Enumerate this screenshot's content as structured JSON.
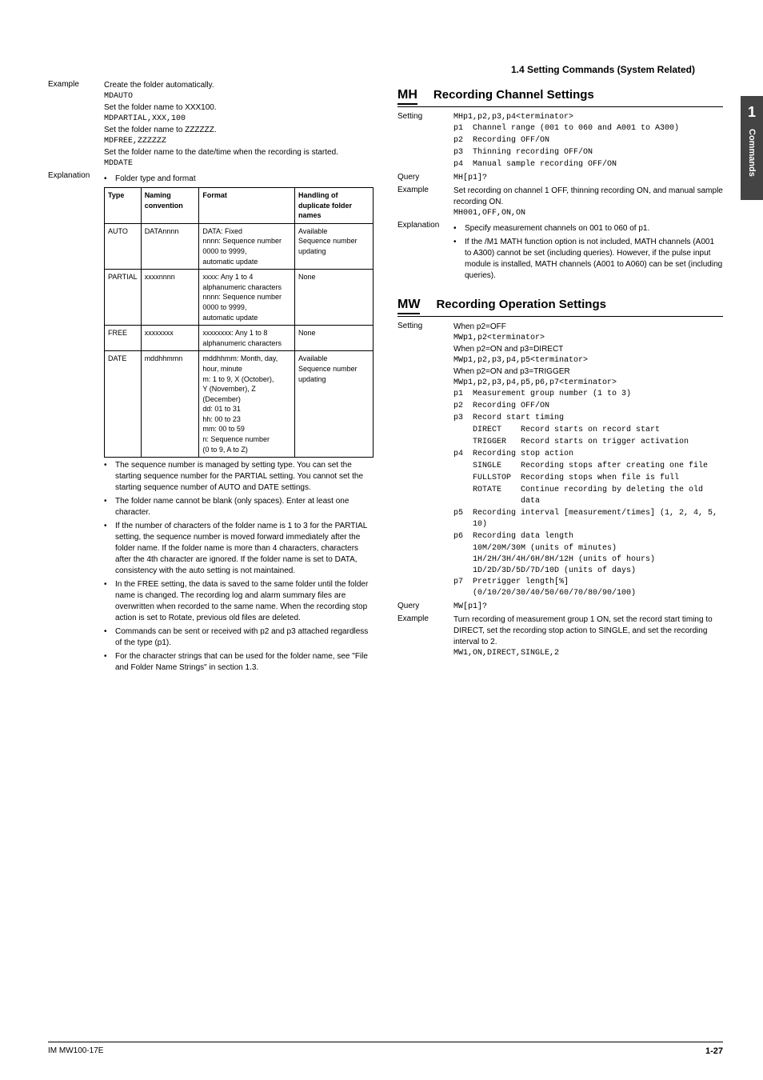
{
  "header_section": "1.4  Setting Commands (System Related)",
  "side": {
    "chapter": "1",
    "label": "Commands"
  },
  "left": {
    "example_label": "Example",
    "example_text": "Create the folder automatically.",
    "ex_lines": [
      {
        "t": "mono",
        "v": "MDAUTO"
      },
      {
        "t": "plain",
        "v": "Set the folder name to XXX100."
      },
      {
        "t": "mono",
        "v": "MDPARTIAL,XXX,100"
      },
      {
        "t": "plain",
        "v": "Set the folder name to ZZZZZZ."
      },
      {
        "t": "mono",
        "v": "MDFREE,ZZZZZZ"
      },
      {
        "t": "plain",
        "v": "Set the folder name to the date/time when the recording is started."
      },
      {
        "t": "mono",
        "v": "MDDATE"
      }
    ],
    "explanation_label": "Explanation",
    "exp_bullet1": "Folder type and format",
    "table": {
      "head": [
        "Type",
        "Naming convention",
        "Format",
        "Handling of duplicate folder names"
      ],
      "rows": [
        [
          "AUTO",
          "DATAnnnn",
          "DATA: Fixed\nnnnn: Sequence number\n     0000 to 9999,\n     automatic update",
          "Available\nSequence number updating"
        ],
        [
          "PARTIAL",
          "xxxxnnnn",
          "xxxx: Any 1 to 4 alphanumeric characters\nnnnn: Sequence number\n     0000 to 9999,\n     automatic update",
          "None"
        ],
        [
          "FREE",
          "xxxxxxxx",
          "xxxxxxxx: Any 1 to 8 alphanumeric characters",
          "None"
        ],
        [
          "DATE",
          "mddhhmmn",
          "mddhhmm: Month, day,\n           hour, minute\nm: 1 to 9, X (October),\n   Y (November), Z\n   (December)\ndd: 01 to 31\nhh: 00 to 23\nmm: 00 to 59\nn: Sequence number\n   (0 to 9, A to Z)",
          "Available\nSequence number updating"
        ]
      ]
    },
    "bullets": [
      "The sequence number is managed by setting type. You can set the starting sequence number for the PARTIAL setting. You cannot set the starting sequence number of AUTO and DATE settings.",
      "The folder name cannot be blank (only spaces). Enter at least one character.",
      "If the number of characters of the folder name is 1 to 3 for the PARTIAL setting, the sequence number is moved forward immediately after the folder name. If the folder name is more than 4 characters, characters after the 4th character are ignored. If the folder name is set to DATA, consistency with the auto setting is not maintained.",
      "In the FREE setting, the data is saved to the same folder until the folder name is changed. The recording log and alarm summary files are overwritten when recorded to the same name. When the recording stop action is set to Rotate, previous old files are deleted.",
      "Commands can be sent or received with p2 and p3 attached regardless of the type (p1).",
      "For the character strings that can be used for the folder name, see \"File and Folder Name Strings\" in section 1.3."
    ]
  },
  "right": {
    "mh": {
      "cmd": "MH",
      "title": "Recording Channel Settings",
      "setting_label": "Setting",
      "setting_syntax": "MHp1,p2,p3,p4<terminator>",
      "params": [
        {
          "n": "p1",
          "d": "Channel range (001 to 060 and A001 to A300)"
        },
        {
          "n": "p2",
          "d": "Recording OFF/ON"
        },
        {
          "n": "p3",
          "d": "Thinning recording OFF/ON"
        },
        {
          "n": "p4",
          "d": "Manual sample recording OFF/ON"
        }
      ],
      "query_label": "Query",
      "query": "MH[p1]?",
      "example_label": "Example",
      "example_text": "Set recording on channel 1 OFF, thinning recording ON, and manual sample recording ON.",
      "example_code": "MH001,OFF,ON,ON",
      "explanation_label": "Explanation",
      "exp_bullets": [
        "Specify measurement channels on 001 to 060 of p1.",
        "If the /M1 MATH function option is not included, MATH channels (A001 to A300) cannot be set (including queries). However, if the pulse input module is installed, MATH channels (A001 to A060) can be set (including queries)."
      ]
    },
    "mw": {
      "cmd": "MW",
      "title": "Recording Operation Settings",
      "setting_label": "Setting",
      "cond1": "When p2=OFF",
      "syn1": "MWp1,p2<terminator>",
      "cond2": "When p2=ON and p3=DIRECT",
      "syn2": "MWp1,p2,p3,p4,p5<terminator>",
      "cond3": "When p2=ON and p3=TRIGGER",
      "syn3": "MWp1,p2,p3,p4,p5,p6,p7<terminator>",
      "params": [
        {
          "n": "p1",
          "d": "Measurement group number (1 to 3)"
        },
        {
          "n": "p2",
          "d": "Recording OFF/ON"
        }
      ],
      "p3_label": "p3",
      "p3_head": "Record   start timing",
      "p3_subs": [
        {
          "n": "DIRECT",
          "d": "Record starts on record start"
        },
        {
          "n": "TRIGGER",
          "d": "Record starts on trigger activation"
        }
      ],
      "p4_label": "p4",
      "p4_head": "Recording stop action",
      "p4_subs": [
        {
          "n": "SINGLE",
          "d": "Recording stops after creating one file"
        },
        {
          "n": "FULLSTOP",
          "d": "Recording stops when file is full"
        },
        {
          "n": "ROTATE",
          "d": "Continue recording by deleting the old data"
        }
      ],
      "p5": {
        "n": "p5",
        "d": "Recording interval [measurement/times] (1, 2, 4, 5, 10)"
      },
      "p6": {
        "n": "p6",
        "d": "Recording data length",
        "lines": [
          "10M/20M/30M (units of minutes)",
          "1H/2H/3H/4H/6H/8H/12H (units of hours)",
          "1D/2D/3D/5D/7D/10D (units of days)"
        ]
      },
      "p7": {
        "n": "p7",
        "d": "Pretrigger length[%] (0/10/20/30/40/50/60/70/80/90/100)"
      },
      "query_label": "Query",
      "query": "MW[p1]?",
      "example_label": "Example",
      "example_text": "Turn recording of measurement group 1 ON, set the record start timing to DIRECT, set the recording stop action to SINGLE, and set the recording interval to 2.",
      "example_code": "MW1,ON,DIRECT,SINGLE,2"
    }
  },
  "footer": {
    "left": "IM MW100-17E",
    "right": "1-27"
  }
}
